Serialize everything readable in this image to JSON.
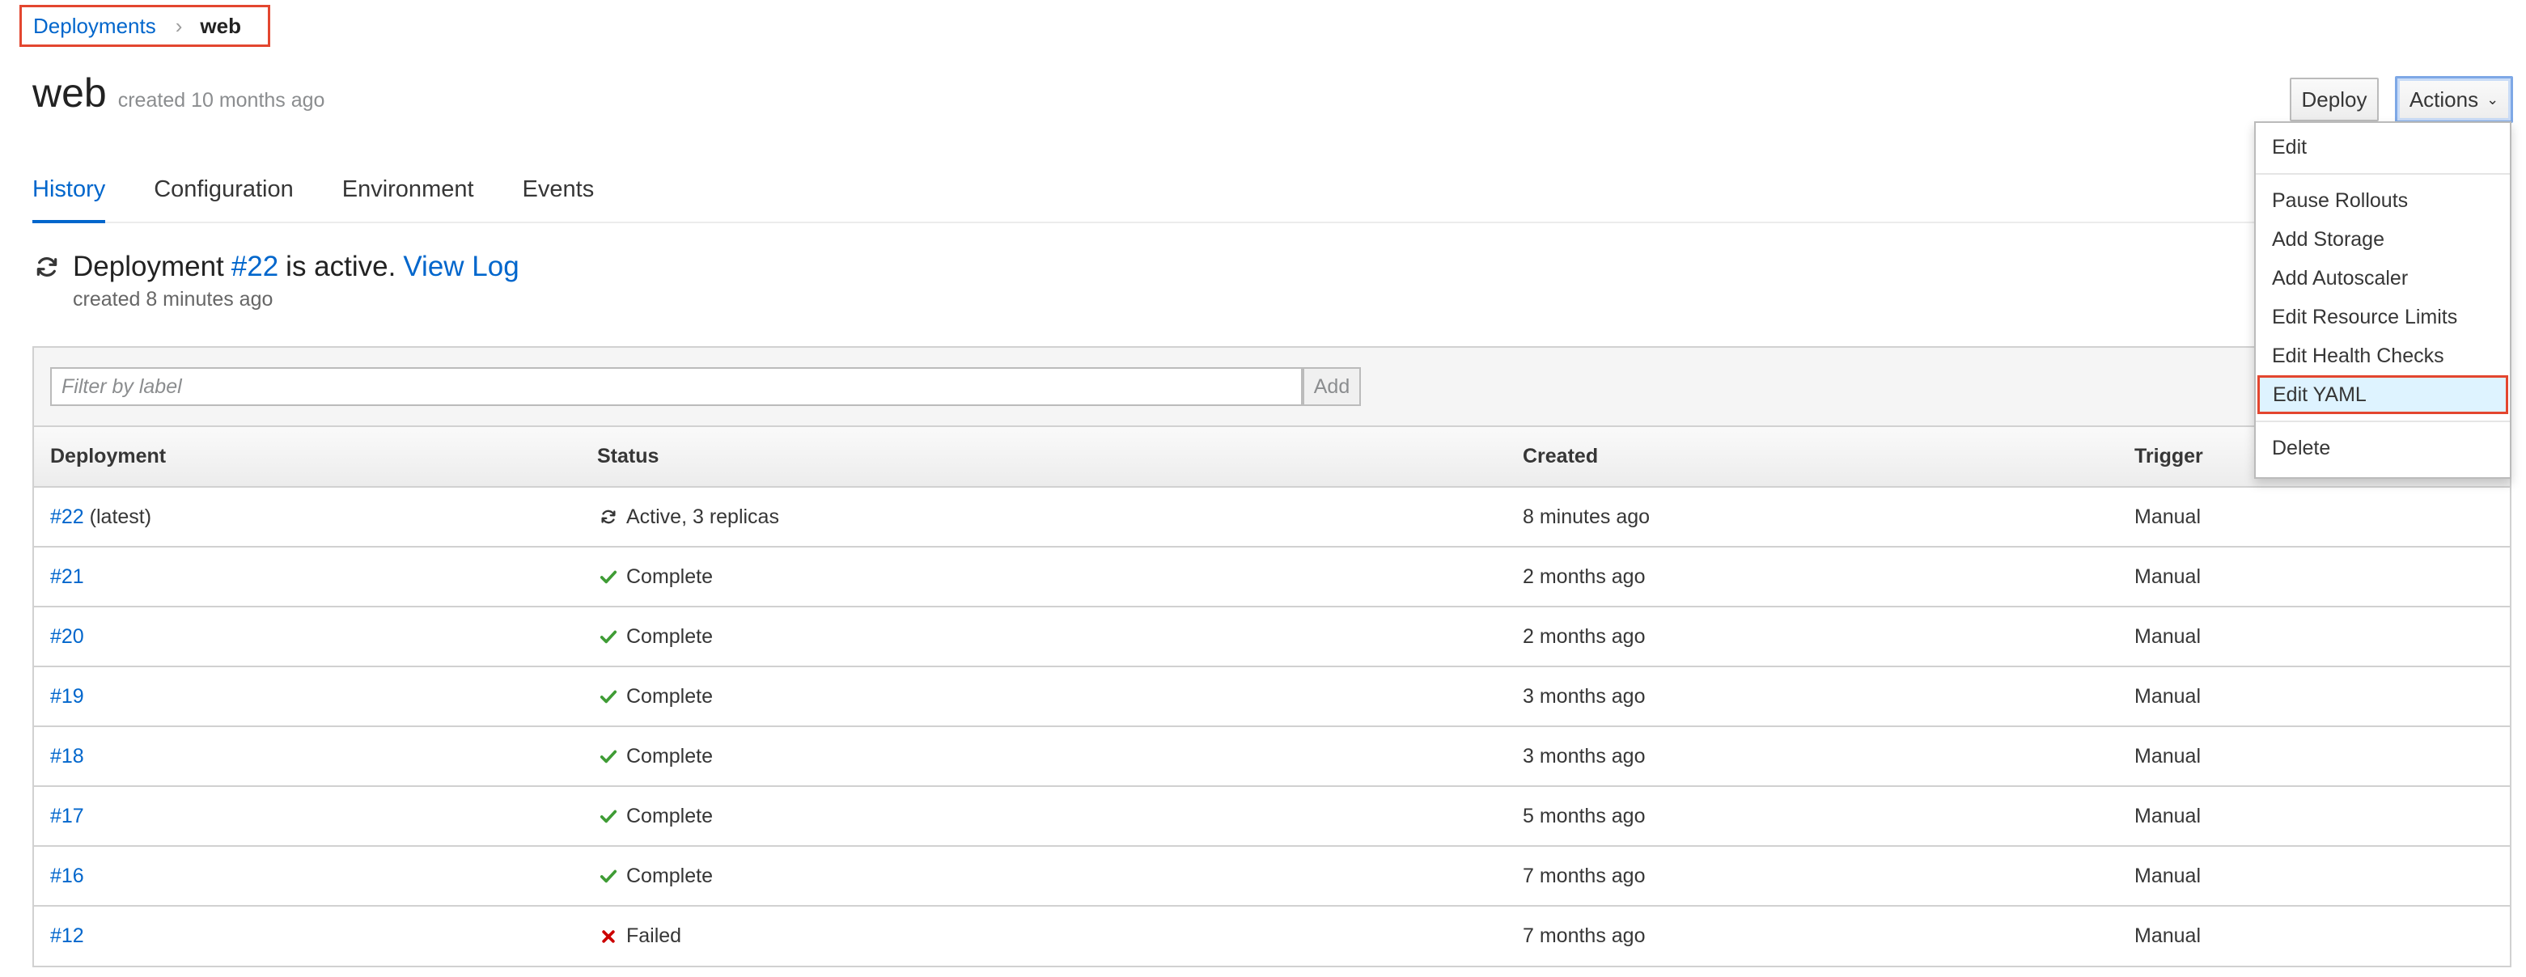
{
  "breadcrumb": {
    "parent": "Deployments",
    "separator": "›",
    "current": "web"
  },
  "header": {
    "title": "web",
    "subtitle": "created 10 months ago",
    "deploy_label": "Deploy",
    "actions_label": "Actions"
  },
  "tabs": [
    {
      "label": "History",
      "active": true
    },
    {
      "label": "Configuration",
      "active": false
    },
    {
      "label": "Environment",
      "active": false
    },
    {
      "label": "Events",
      "active": false
    }
  ],
  "notice": {
    "prefix": "Deployment",
    "deployment_link": "#22",
    "middle": "is active.",
    "view_log": "View Log",
    "created": "created 8 minutes ago"
  },
  "filter": {
    "placeholder": "Filter by label",
    "add_label": "Add"
  },
  "table": {
    "columns": [
      "Deployment",
      "Status",
      "Created",
      "Trigger"
    ],
    "rows": [
      {
        "id": "#22",
        "suffix": "(latest)",
        "status": "Active, 3 replicas",
        "status_icon": "refresh-icon",
        "created": "8 minutes ago",
        "trigger": "Manual"
      },
      {
        "id": "#21",
        "suffix": "",
        "status": "Complete",
        "status_icon": "check-icon",
        "created": "2 months ago",
        "trigger": "Manual"
      },
      {
        "id": "#20",
        "suffix": "",
        "status": "Complete",
        "status_icon": "check-icon",
        "created": "2 months ago",
        "trigger": "Manual"
      },
      {
        "id": "#19",
        "suffix": "",
        "status": "Complete",
        "status_icon": "check-icon",
        "created": "3 months ago",
        "trigger": "Manual"
      },
      {
        "id": "#18",
        "suffix": "",
        "status": "Complete",
        "status_icon": "check-icon",
        "created": "3 months ago",
        "trigger": "Manual"
      },
      {
        "id": "#17",
        "suffix": "",
        "status": "Complete",
        "status_icon": "check-icon",
        "created": "5 months ago",
        "trigger": "Manual"
      },
      {
        "id": "#16",
        "suffix": "",
        "status": "Complete",
        "status_icon": "check-icon",
        "created": "7 months ago",
        "trigger": "Manual"
      },
      {
        "id": "#12",
        "suffix": "",
        "status": "Failed",
        "status_icon": "x-icon",
        "created": "7 months ago",
        "trigger": "Manual"
      }
    ]
  },
  "actions_menu": {
    "items": [
      "Edit",
      "Pause Rollouts",
      "Add Storage",
      "Add Autoscaler",
      "Edit Resource Limits",
      "Edit Health Checks",
      "Edit YAML",
      "Delete"
    ],
    "highlighted": "Edit YAML"
  },
  "colors": {
    "link": "#0066cc",
    "success": "#3f9c35",
    "danger": "#cc0000",
    "highlight_border": "#e3462f",
    "menu_highlight": "#def3ff"
  }
}
